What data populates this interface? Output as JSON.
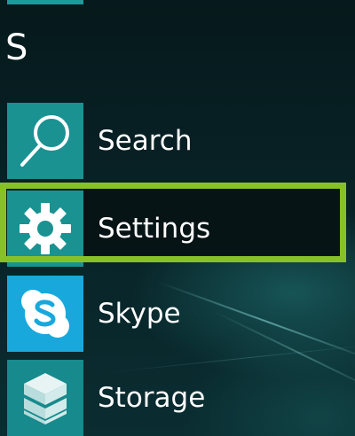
{
  "group_header": "S",
  "apps": [
    {
      "id": "search",
      "label": "Search",
      "icon": "magnifier-icon",
      "tile_color": "#1a9292"
    },
    {
      "id": "settings",
      "label": "Settings",
      "icon": "gear-icon",
      "tile_color": "#1a9292",
      "highlighted": true
    },
    {
      "id": "skype",
      "label": "Skype",
      "icon": "skype-icon",
      "tile_color": "#19a8dc"
    },
    {
      "id": "storage",
      "label": "Storage",
      "icon": "storage-stack-icon",
      "tile_color": "#168a8c"
    }
  ],
  "highlight_color": "#86c226"
}
